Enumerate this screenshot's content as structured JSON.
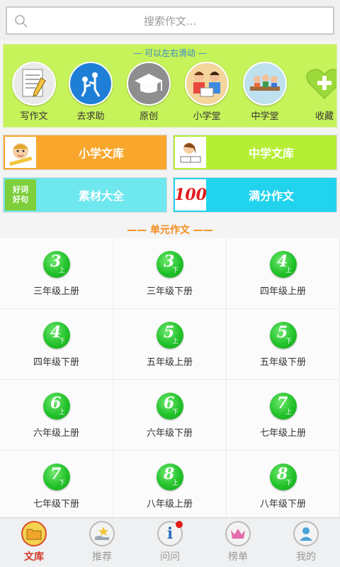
{
  "search": {
    "placeholder": "搜索作文..."
  },
  "categories": {
    "hint": "— 可以左右滑动 —",
    "items": [
      {
        "label": "写作文",
        "icon": "writing-paper-icon"
      },
      {
        "label": "去求助",
        "icon": "helping-hand-icon"
      },
      {
        "label": "原创",
        "icon": "graduation-cap-icon"
      },
      {
        "label": "小学堂",
        "icon": "children-reading-icon"
      },
      {
        "label": "中学堂",
        "icon": "classroom-students-icon"
      },
      {
        "label": "收藏",
        "icon": "heart-plus-icon"
      }
    ]
  },
  "library": {
    "primary": {
      "label": "小学文库",
      "color": "#f8a72c"
    },
    "middle": {
      "label": "中学文库",
      "color": "#b5ee35"
    },
    "materials": {
      "label": "素材大全",
      "color": "#6fe7ee",
      "badge_text": "好词好句"
    },
    "fullscore": {
      "label": "满分作文",
      "color": "#22d3ee",
      "badge_text": "100"
    }
  },
  "units": {
    "title": "—— 单元作文 ——",
    "grades": [
      {
        "num": "3",
        "sub": "上",
        "label": "三年级上册"
      },
      {
        "num": "3",
        "sub": "下",
        "label": "三年级下册"
      },
      {
        "num": "4",
        "sub": "上",
        "label": "四年级上册"
      },
      {
        "num": "4",
        "sub": "下",
        "label": "四年级下册"
      },
      {
        "num": "5",
        "sub": "上",
        "label": "五年级上册"
      },
      {
        "num": "5",
        "sub": "下",
        "label": "五年级下册"
      },
      {
        "num": "6",
        "sub": "上",
        "label": "六年级上册"
      },
      {
        "num": "6",
        "sub": "下",
        "label": "六年级下册"
      },
      {
        "num": "7",
        "sub": "上",
        "label": "七年级上册"
      },
      {
        "num": "7",
        "sub": "下",
        "label": "七年级下册"
      },
      {
        "num": "8",
        "sub": "上",
        "label": "八年级上册"
      },
      {
        "num": "8",
        "sub": "下",
        "label": "八年级下册"
      }
    ]
  },
  "nav": {
    "items": [
      {
        "label": "文库",
        "icon": "folder-icon",
        "active": true
      },
      {
        "label": "推荐",
        "icon": "hand-star-icon"
      },
      {
        "label": "问问",
        "icon": "info-icon",
        "notification": true
      },
      {
        "label": "榜单",
        "icon": "crown-icon"
      },
      {
        "label": "我的",
        "icon": "user-icon"
      }
    ]
  },
  "colors": {
    "accent_green": "#c6f25a",
    "orange": "#f08c1b",
    "active_red": "#d23a2a"
  }
}
